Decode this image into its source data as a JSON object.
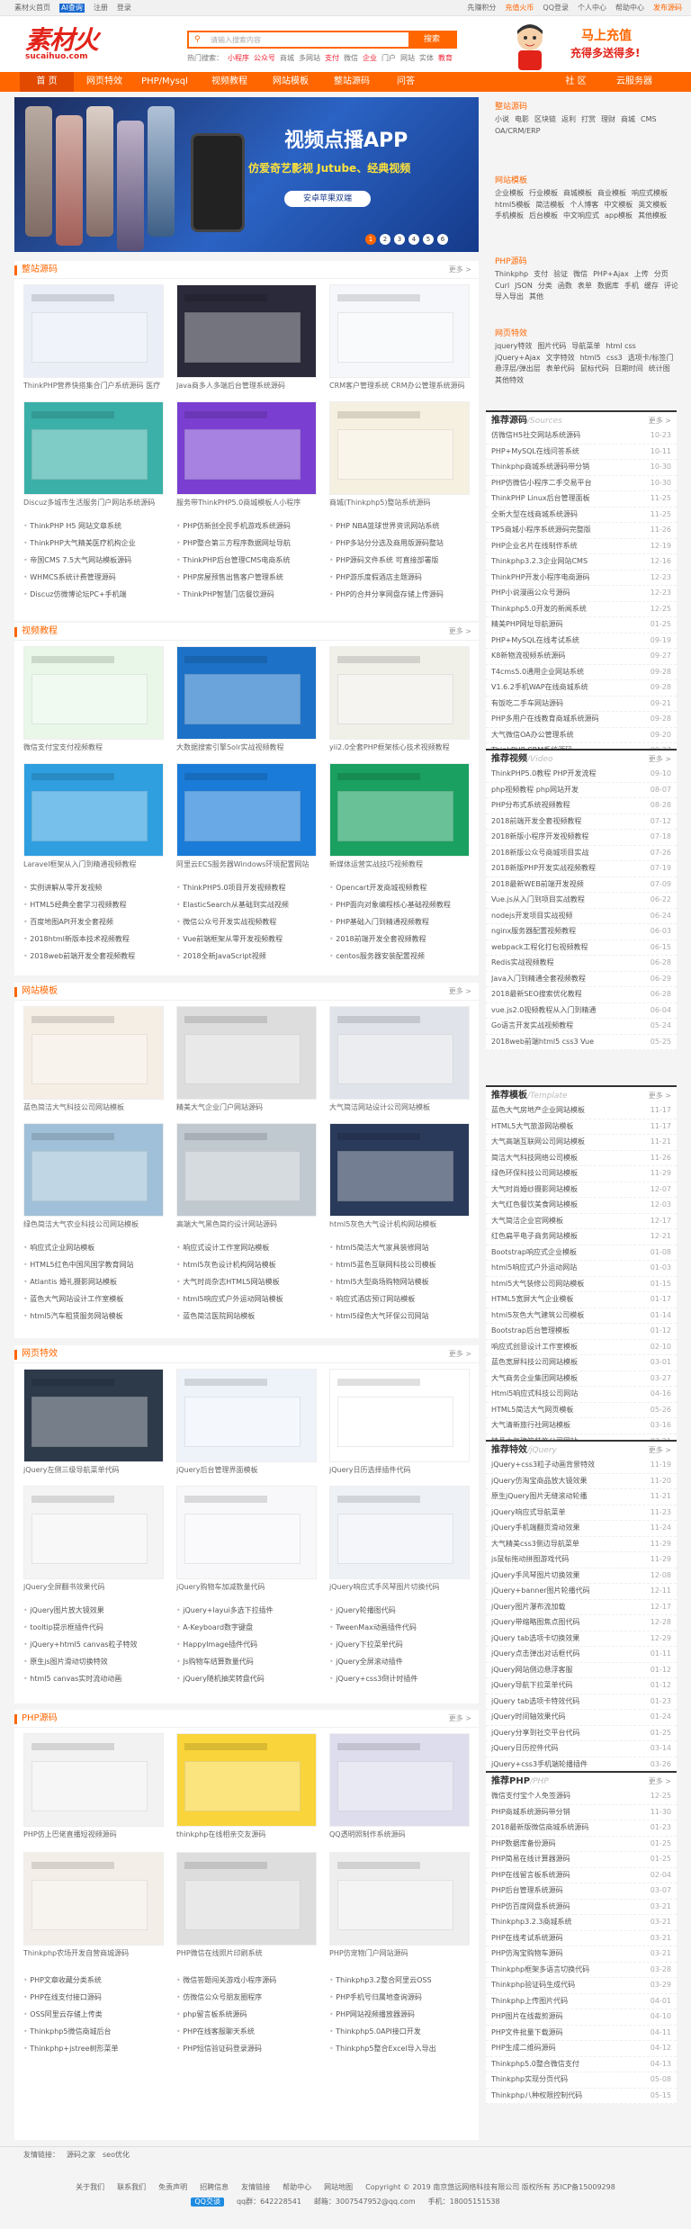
{
  "topbar": {
    "left": [
      "素材火首页",
      "AI查询",
      "注册",
      "登录"
    ],
    "right": [
      "先赚积分",
      "充值火币",
      "QQ登录",
      "个人中心",
      "帮助中心",
      "发布源码"
    ]
  },
  "logo": {
    "main": "素材火",
    "sub": "sucaihuo.com"
  },
  "search": {
    "placeholder": "请输入搜索内容",
    "button": "搜索",
    "hot_label": "热门搜索：",
    "hot": [
      "小程序",
      "公众号",
      "商城",
      "多网站",
      "支付",
      "微信",
      "企业",
      "门户",
      "网站",
      "实体",
      "教育"
    ]
  },
  "promo": {
    "line1": "马上充值",
    "line2": "充得多送得多!"
  },
  "nav": [
    "首 页",
    "网页特效",
    "PHP/Mysql",
    "视频教程",
    "网站模板",
    "整站源码",
    "问答",
    "社 区",
    "云服务器"
  ],
  "banner": {
    "title": "视频点播APP",
    "subtitle": "仿爱奇艺影视 Jutube、经典视频",
    "button": "安卓苹果双端",
    "pages": [
      "1",
      "2",
      "3",
      "4",
      "5",
      "6"
    ]
  },
  "sections": [
    {
      "title": "整站源码",
      "more": "更多 >",
      "cards": [
        "ThinkPHP营养快搭集合门户系统源码 医疗",
        "Java商多人多端后台管理系统源码",
        "CRM客户管理系统 CRM办公管理系统源码",
        "Discuz多城市生活服务门户网站系统源码",
        "服务带ThinkPHP5.0商城模板人小程序",
        "商城(Thinkphp5)整站系统源码"
      ],
      "list": [
        "ThinkPHP H5 网站文章系统",
        "PHP仿新创全民手机游戏系统源码",
        "PHP NBA篮球世界资讯网站系统",
        "ThinkPHP大气精美医疗机构企业",
        "PHP整合第三方程序数据网址导航",
        "PHP多站分分选及商用版源码整站",
        "帝国CMS 7.5大气网站模板源码",
        "ThinkPHP后台管理CMS电商系统",
        "PHP源码文件系统 可直接部署版",
        "WHMCS系统计费管理源码",
        "PHP房屋预售出售客户管理系统",
        "PHP游乐度假酒店主题源码",
        "Discuz仿微博论坛PC+手机端",
        "ThinkPHP智慧门店餐饮源码",
        "PHP的合并分享网盘存储上传源码"
      ]
    },
    {
      "title": "视频教程",
      "more": "更多 >",
      "cards": [
        "微信支付宝支付视频教程",
        "大数据搜索引擎Solr实战视频教程",
        "yii2.0全套PHP框架核心技术视频教程",
        "Laravel框架从入门到精通视频教程",
        "阿里云ECS服务器Windows环境配置网站",
        "新媒体运营实战技巧视频教程"
      ],
      "list": [
        "实例讲解从零开发视频",
        "ThinkPHP5.0项目开发视频教程",
        "Opencart开发商城视频教程",
        "HTML5经典全套学习视频教程",
        "ElasticSearch从基础到实战视频",
        "PHP面向对象编程核心基础视频教程",
        "百度地图API开发全套视频",
        "微信公众号开发实战视频教程",
        "PHP基础入门到精通视频教程",
        "2018html新版本技术视频教程",
        "Vue前端框架从零开发视频教程",
        "2018前端开发全套视频教程",
        "2018web前端开发全套视频教程",
        "2018全新JavaScript视频",
        "centos服务器安装配置视频"
      ]
    },
    {
      "title": "网站模板",
      "more": "更多 >",
      "cards": [
        "蓝色简洁大气科技公司网站模板",
        "精美大气企业门户网站源码",
        "大气简洁网站设计公司网站模板",
        "绿色简洁大气农业科技公司网站模板",
        "高端大气黑色简约设计网站源码",
        "html5灰色大气设计机构网站模板"
      ],
      "list": [
        "响应式企业网站模板",
        "响应式设计工作室网站模板",
        "html5简洁大气家具装修网站",
        "HTML5红色中国风国学教育网站",
        "html5灰色设计机构网站模板",
        "html5蓝色互联网科技公司模板",
        "Atlantis 婚礼摄影网站模板",
        "大气时尚杂志HTML5网站模板",
        "html5大型商场购物网站模板",
        "蓝色大气网站设计工作室模板",
        "html5响应式户外运动网站模板",
        "响应式酒店预订网站模板",
        "html5汽车租赁服务网站模板",
        "蓝色简洁医院网站模板",
        "html5绿色大气环保公司网站"
      ]
    },
    {
      "title": "网页特效",
      "more": "更多 >",
      "cards": [
        "jQuery左侧三级导航菜单代码",
        "jQuery后台管理界面模板",
        "jQuery日历选择插件代码",
        "jQuery全屏翻书效果代码",
        "jQuery购物车加减数量代码",
        "jQuery响应式手风琴图片切换代码"
      ],
      "list": [
        "jQuery图片放大镜效果",
        "jQuery+layui多选下拉插件",
        "jQuery轮播图代码",
        "tooltip提示框插件代码",
        "A-Keyboard数字键盘",
        "TweenMax动画插件代码",
        "jQuery+html5 canvas粒子特效",
        "HappyImage插件代码",
        "jQuery下拉菜单代码",
        "原生js图片滑动切换特效",
        "Js购物车结算数量代码",
        "jQuery全屏滚动插件",
        "html5 canvas实时流动动画",
        "jQuery随机抽奖转盘代码",
        "jQuery+css3倒计时插件"
      ]
    },
    {
      "title": "PHP源码",
      "more": "更多 >",
      "cards": [
        "PHP仿上巴佬直播短视频源码",
        "thinkphp在线相亲交友源码",
        "QQ透明照制作系统源码",
        "Thinkphp农场开发自营商城源码",
        "PHP微信在线照片印刷系统",
        "PHP仿宠物门户网站源码"
      ],
      "list": [
        "PHP文章收藏分类系统",
        "微信答题闯关游戏小程序源码",
        "Thinkphp3.2整合阿里云OSS",
        "PHP在线支付接口源码",
        "仿微信公众号朋友圈程序",
        "PHP手机号归属地查询源码",
        "OSS阿里云存储上传类",
        "php留言板系统源码",
        "PHP网站视频播放器源码",
        "Thinkphp5微信商城后台",
        "PHP在线客服聊天系统",
        "Thinkphp5.0API接口开发",
        "Thinkphp+jstree树形菜单",
        "PHP短信验证码登录源码",
        "Thinkphp5整合Excel导入导出"
      ]
    }
  ],
  "side_tags": [
    {
      "title": "整站源码",
      "tags": [
        "小说",
        "电影",
        "区块链",
        "返利",
        "打赏",
        "理财",
        "商城",
        "CMS",
        "OA/CRM/ERP"
      ]
    },
    {
      "title": "网站模板",
      "tags": [
        "企业模板",
        "行业模板",
        "商城模板",
        "商业模板",
        "响应式模板",
        "html5模板",
        "简洁模板",
        "个人博客",
        "中文模板",
        "英文模板",
        "手机模板",
        "后台模板",
        "中文响应式",
        "app模板",
        "其他模板"
      ]
    },
    {
      "title": "PHP源码",
      "tags": [
        "Thinkphp",
        "支付",
        "验证",
        "微信",
        "PHP+Ajax",
        "上传",
        "分页",
        "Curl",
        "JSON",
        "分类",
        "函数",
        "表单",
        "数据库",
        "手机",
        "缓存",
        "评论",
        "导入导出",
        "其他"
      ]
    },
    {
      "title": "网页特效",
      "tags": [
        "jquery特效",
        "图片代码",
        "导航菜单",
        "html css",
        "jQuery+Ajax",
        "文字特效",
        "html5",
        "css3",
        "选项卡/标签门",
        "悬浮层/弹出层",
        "表单代码",
        "鼠标代码",
        "日期时间",
        "统计图",
        "其他特效"
      ]
    }
  ],
  "rankings": [
    {
      "title": "推荐源码",
      "en": "/Sources",
      "more": "更多 >",
      "items": [
        [
          "仿微信H5社交网站系统源码",
          "10-23"
        ],
        [
          "PHP+MySQL在线问答系统",
          "10-11"
        ],
        [
          "Thinkphp商城系统源码带分销",
          "10-30"
        ],
        [
          "PHP仿微信小程序二手交易平台",
          "10-30"
        ],
        [
          "ThinkPHP Linux后台管理面板",
          "11-25"
        ],
        [
          "全新大型在线商城系统源码",
          "11-25"
        ],
        [
          "TP5商城小程序系统源码完整版",
          "11-26"
        ],
        [
          "PHP企业名片在线制作系统",
          "12-19"
        ],
        [
          "Thinkphp3.2.3企业网站CMS",
          "12-16"
        ],
        [
          "ThinkPHP开发小程序电商源码",
          "12-23"
        ],
        [
          "PHP小说漫画公众号源码",
          "12-23"
        ],
        [
          "Thinkphp5.0开发的新闻系统",
          "12-25"
        ],
        [
          "精美PHP网址导航源码",
          "01-25"
        ],
        [
          "PHP+MySQL在线考试系统",
          "09-19"
        ],
        [
          "K8新物流视频系统源码",
          "09-27"
        ],
        [
          "T4cms5.0通用企业网站系统",
          "09-28"
        ],
        [
          "V1.6.2手机WAP在线商城系统",
          "09-28"
        ],
        [
          "有饭吃二手车网站源码",
          "09-21"
        ],
        [
          "PHP多用户在线教育商城系统源码",
          "09-28"
        ],
        [
          "大气微信OA办公管理系统",
          "09-20"
        ],
        [
          "ThinkPHP CRM系统源码",
          "09-27"
        ]
      ]
    },
    {
      "title": "推荐视频",
      "en": "/Video",
      "more": "更多 >",
      "items": [
        [
          "ThinkPHP5.0教程 PHP开发流程",
          "09-10"
        ],
        [
          "php视频教程 php网站开发",
          "08-07"
        ],
        [
          "PHP分布式系统视频教程",
          "08-28"
        ],
        [
          "2018前端开发全套视频教程",
          "07-12"
        ],
        [
          "2018新版小程序开发视频教程",
          "07-18"
        ],
        [
          "2018新版公众号商城项目实战",
          "07-26"
        ],
        [
          "2018新版PHP开发实战视频教程",
          "07-19"
        ],
        [
          "2018最新WEB前端开发视频",
          "07-09"
        ],
        [
          "Vue.js从入门到项目实战教程",
          "06-22"
        ],
        [
          "nodejs开发项目实战视频",
          "06-24"
        ],
        [
          "nginx服务器配置视频教程",
          "06-03"
        ],
        [
          "webpack工程化打包视频教程",
          "06-15"
        ],
        [
          "Redis实战视频教程",
          "06-28"
        ],
        [
          "Java入门到精通全套视频教程",
          "06-29"
        ],
        [
          "2018最新SEO搜索优化教程",
          "06-28"
        ],
        [
          "vue.js2.0视频教程从入门到精通",
          "06-04"
        ],
        [
          "Go语言开发实战视频教程",
          "05-24"
        ],
        [
          "2018web前端html5 css3 Vue",
          "05-25"
        ]
      ]
    },
    {
      "title": "推荐模板",
      "en": "/Template",
      "more": "更多 >",
      "items": [
        [
          "蓝色大气房地产企业网站模板",
          "11-17"
        ],
        [
          "HTML5大气旅游网站模板",
          "11-17"
        ],
        [
          "大气高端互联网公司网站模板",
          "11-21"
        ],
        [
          "简洁大气科技网络公司模板",
          "11-26"
        ],
        [
          "绿色环保科技公司网站模板",
          "11-29"
        ],
        [
          "大气时尚婚纱摄影网站模板",
          "12-07"
        ],
        [
          "大气红色餐饮美食网站模板",
          "12-03"
        ],
        [
          "大气简洁企业官网模板",
          "12-17"
        ],
        [
          "红色扁平电子商务网站模板",
          "12-21"
        ],
        [
          "Bootstrap响应式企业模板",
          "01-08"
        ],
        [
          "html5响应式户外运动网站",
          "01-03"
        ],
        [
          "html5大气装修公司网站模板",
          "01-15"
        ],
        [
          "HTML5宽屏大气企业模板",
          "01-17"
        ],
        [
          "html5灰色大气建筑公司模板",
          "01-14"
        ],
        [
          "Bootstrap后台管理模板",
          "01-12"
        ],
        [
          "响应式创意设计工作室模板",
          "02-10"
        ],
        [
          "蓝色宽屏科技公司网站模板",
          "03-01"
        ],
        [
          "大气商务企业集团网站模板",
          "03-27"
        ],
        [
          "Html5响应式科技公司网站",
          "04-16"
        ],
        [
          "HTML5简洁大气网页模板",
          "05-26"
        ],
        [
          "大气清新旅行社网站模板",
          "03-16"
        ],
        [
          "精品大气建筑装饰公司网站",
          "03-21"
        ]
      ]
    },
    {
      "title": "推荐特效",
      "en": "/jQuery",
      "more": "更多 >",
      "items": [
        [
          "jQuery+css3粒子动画背景特效",
          "11-19"
        ],
        [
          "jQuery仿淘宝商品放大镜效果",
          "11-20"
        ],
        [
          "原生jQuery图片无缝滚动轮播",
          "11-21"
        ],
        [
          "jQuery响应式导航菜单",
          "11-23"
        ],
        [
          "jQuery手机端翻页滑动效果",
          "11-24"
        ],
        [
          "大气精美css3侧边导航菜单",
          "11-29"
        ],
        [
          "js鼠标拖动拼图游戏代码",
          "11-29"
        ],
        [
          "jQuery手风琴图片切换效果",
          "12-08"
        ],
        [
          "jQuery+banner图片轮播代码",
          "12-11"
        ],
        [
          "jQuery图片瀑布流加载",
          "12-17"
        ],
        [
          "jQuery带缩略图焦点图代码",
          "12-28"
        ],
        [
          "jQuery tab选项卡切换效果",
          "12-29"
        ],
        [
          "jQuery点击弹出对话框代码",
          "01-11"
        ],
        [
          "jQuery网站侧边悬浮客服",
          "01-12"
        ],
        [
          "jQuery导航下拉菜单代码",
          "01-12"
        ],
        [
          "jQuery tab选项卡特效代码",
          "01-23"
        ],
        [
          "jQuery时间轴效果代码",
          "01-24"
        ],
        [
          "jQuery分享到社交平台代码",
          "01-25"
        ],
        [
          "jQuery日历控件代码",
          "03-14"
        ],
        [
          "jQuery+css3手机端轮播插件",
          "03-26"
        ],
        [
          "jQuery图片上传预览代码",
          "04-06"
        ]
      ]
    },
    {
      "title": "推荐PHP",
      "en": "/PHP",
      "more": "更多 >",
      "items": [
        [
          "微信支付宝个人免签源码",
          "12-25"
        ],
        [
          "PHP商城系统源码带分销",
          "11-30"
        ],
        [
          "2018最新版微信商城系统源码",
          "01-23"
        ],
        [
          "PHP数据库备份源码",
          "01-25"
        ],
        [
          "PHP简易在线计算器源码",
          "01-25"
        ],
        [
          "PHP在线留言板系统源码",
          "02-04"
        ],
        [
          "PHP后台管理系统源码",
          "03-07"
        ],
        [
          "PHP仿百度网盘系统源码",
          "03-21"
        ],
        [
          "Thinkphp3.2.3商城系统",
          "03-21"
        ],
        [
          "PHP在线考试系统源码",
          "03-21"
        ],
        [
          "PHP仿淘宝购物车源码",
          "03-21"
        ],
        [
          "Thinkphp框架多语言切换代码",
          "03-28"
        ],
        [
          "Thinkphp验证码生成代码",
          "03-29"
        ],
        [
          "Thinkphp上传图片代码",
          "04-01"
        ],
        [
          "PHP图片在线裁剪源码",
          "04-10"
        ],
        [
          "PHP文件批量下载源码",
          "04-11"
        ],
        [
          "PHP生成二维码源码",
          "04-12"
        ],
        [
          "Thinkphp5.0整合微信支付",
          "04-13"
        ],
        [
          "Thinkphp实现分页代码",
          "05-08"
        ],
        [
          "Thinkphp八种权限控制代码",
          "05-15"
        ]
      ]
    }
  ],
  "footer": {
    "links": [
      "友情链接：",
      "源码之家",
      "seo优化"
    ],
    "nav": [
      "关于我们",
      "联系我们",
      "免责声明",
      "招聘信息",
      "友情链接",
      "帮助中心",
      "网站地图"
    ],
    "contact": {
      "qq_label": "QQ交谈",
      "qq": "qq群：642228541",
      "email": "邮箱：3007547952@qq.com",
      "phone": "手机：18005151538"
    },
    "copyright": "Copyright © 2019 南京悠远网络科技有限公司 版权所有 苏ICP备15009298"
  },
  "colors": {
    "accent": "#f60",
    "brand": "#e2231a"
  }
}
